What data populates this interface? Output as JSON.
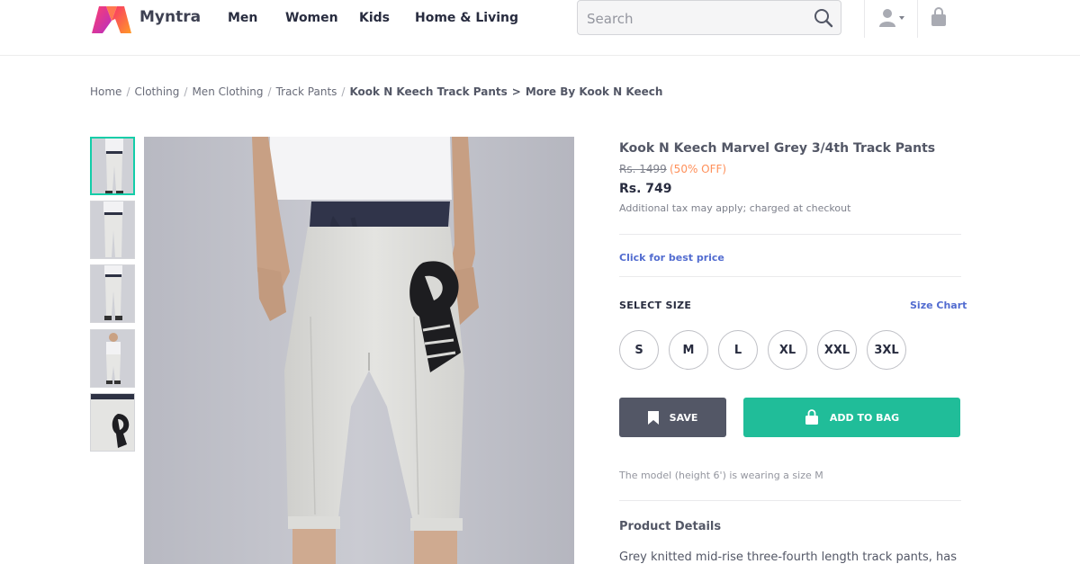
{
  "header": {
    "brand": "Myntra",
    "nav": [
      "Men",
      "Women",
      "Kids",
      "Home & Living"
    ],
    "search_placeholder": "Search"
  },
  "breadcrumb": {
    "items": [
      "Home",
      "Clothing",
      "Men Clothing",
      "Track Pants"
    ],
    "current": "Kook N Keech Track Pants",
    "arrow": ">",
    "more": "More By Kook N Keech"
  },
  "product": {
    "title": "Kook N Keech Marvel Grey 3/4th Track Pants",
    "mrp": "Rs. 1499",
    "discount": "(50% OFF)",
    "price": "Rs. 749",
    "tax_note": "Additional tax may apply; charged at checkout",
    "best_price_link": "Click for best price",
    "select_size_label": "SELECT SIZE",
    "size_chart_link": "Size Chart",
    "sizes": [
      "S",
      "M",
      "L",
      "XL",
      "XXL",
      "3XL"
    ],
    "save_label": "SAVE",
    "add_to_bag_label": "ADD TO BAG",
    "model_note": "The model (height 6') is wearing a size M",
    "details_heading": "Product Details",
    "details_text": "Grey knitted mid-rise three-fourth length track pants, has"
  },
  "thumbnails": {
    "count": 5,
    "active_index": 0
  },
  "colors": {
    "accent_green": "#20bd99",
    "save_button": "#535766",
    "link_blue": "#526cd0",
    "discount_orange": "#ff905a",
    "active_thumb_border": "#14cda8"
  },
  "icons": [
    "myntra-logo",
    "search-icon",
    "user-icon",
    "bag-icon",
    "bookmark-icon",
    "shopping-bag-icon"
  ]
}
